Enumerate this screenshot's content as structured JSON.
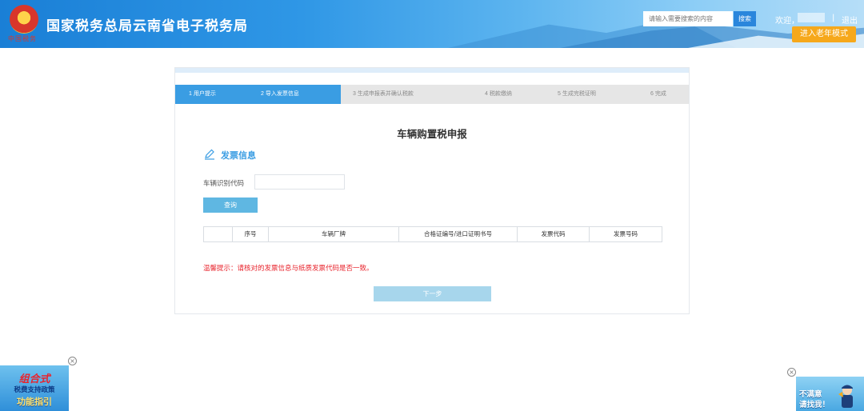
{
  "header": {
    "title": "国家税务总局云南省电子税务局",
    "emblem_text": "中国税务",
    "search_placeholder": "请输入需要搜索的内容",
    "search_button": "搜索",
    "welcome": "欢迎，",
    "divider": "|",
    "logout": "退出",
    "elder_mode": "进入老年模式"
  },
  "steps": [
    {
      "label": "1  用户提示",
      "state": "done"
    },
    {
      "label": "2  导入发票信息",
      "state": "active"
    },
    {
      "label": "3  生成申报表并确认税款",
      "state": "pending"
    },
    {
      "label": "4  税款缴纳",
      "state": "pending"
    },
    {
      "label": "5  生成完税证明",
      "state": "pending"
    },
    {
      "label": "6  完成",
      "state": "pending"
    }
  ],
  "form": {
    "title": "车辆购置税申报",
    "section_title": "发票信息",
    "vin_label": "车辆识别代码",
    "vin_value": "",
    "query_button": "查询",
    "table_headers": [
      "",
      "序号",
      "车辆厂牌",
      "合格证编号/进口证明书号",
      "发票代码",
      "发票号码"
    ],
    "tip": "温馨提示：请核对的发票信息与纸质发票代码是否一致。",
    "next_button": "下一步"
  },
  "ads": {
    "left": {
      "line1": "组合式",
      "line2": "税费支持政策",
      "line3": "功能指引"
    },
    "right": {
      "line1": "不满意",
      "line2": "请找我！"
    },
    "close_symbol": "×"
  },
  "colors": {
    "header_blue": "#1a7fd6",
    "step_active": "#3a9de3",
    "section_blue": "#3a9de3",
    "elder_orange": "#f6a81b",
    "tip_red": "#e8242d"
  }
}
